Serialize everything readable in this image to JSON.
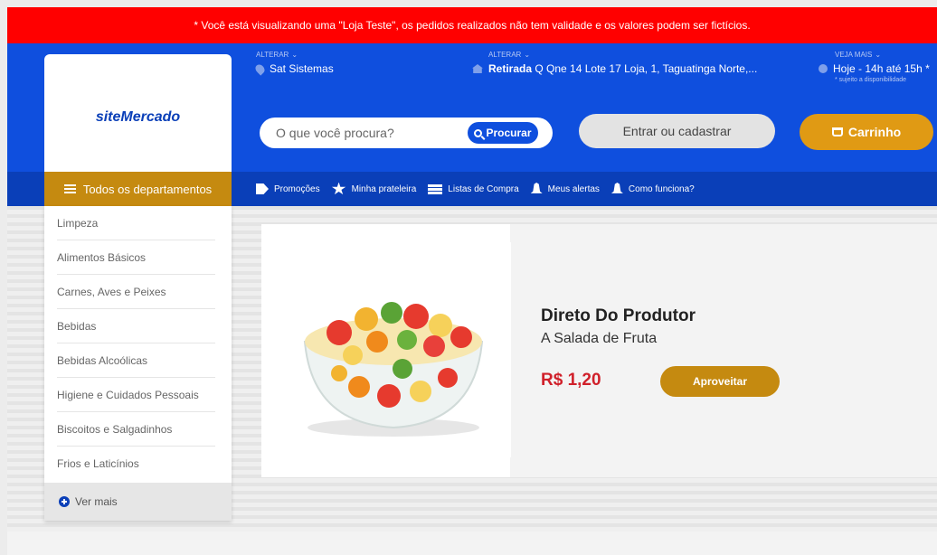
{
  "warning": "* Você está visualizando uma \"Loja Teste\", os pedidos realizados não tem validade e os valores podem ser fictícios.",
  "header": {
    "store": {
      "label": "ALTERAR",
      "value": "Sat Sistemas"
    },
    "pickup": {
      "label": "ALTERAR",
      "value_bold": "Retirada",
      "value": " Q Qne 14 Lote 17 Loja, 1, Taguatinga Norte,..."
    },
    "schedule": {
      "label": "VEJA MAIS",
      "value": "Hoje - 14h até 15h *",
      "note": "* sujeito a disponibilidade"
    },
    "logo": "siteMercado",
    "search_placeholder": "O que você procura?",
    "search_button": "Procurar",
    "login": "Entrar ou cadastrar",
    "cart": "Carrinho"
  },
  "nav": {
    "departments": "Todos os departamentos",
    "links": [
      "Promoções",
      "Minha prateleira",
      "Listas de Compra",
      "Meus alertas",
      "Como funciona?"
    ]
  },
  "departments": [
    "Limpeza",
    "Alimentos Básicos",
    "Carnes, Aves e Peixes",
    "Bebidas",
    "Bebidas Alcoólicas",
    "Higiene e Cuidados Pessoais",
    "Biscoitos e Salgadinhos",
    "Frios e Laticínios"
  ],
  "ver_mais": "Ver mais",
  "banner": {
    "title": "Direto Do Produtor",
    "subtitle": "A Salada de Fruta",
    "price": "R$ 1,20",
    "button": "Aproveitar"
  },
  "colors": {
    "red": "#ff0000",
    "blue": "#0f4fde",
    "dark_blue": "#0a3fb8",
    "gold": "#c58a10",
    "price": "#d0202a"
  }
}
